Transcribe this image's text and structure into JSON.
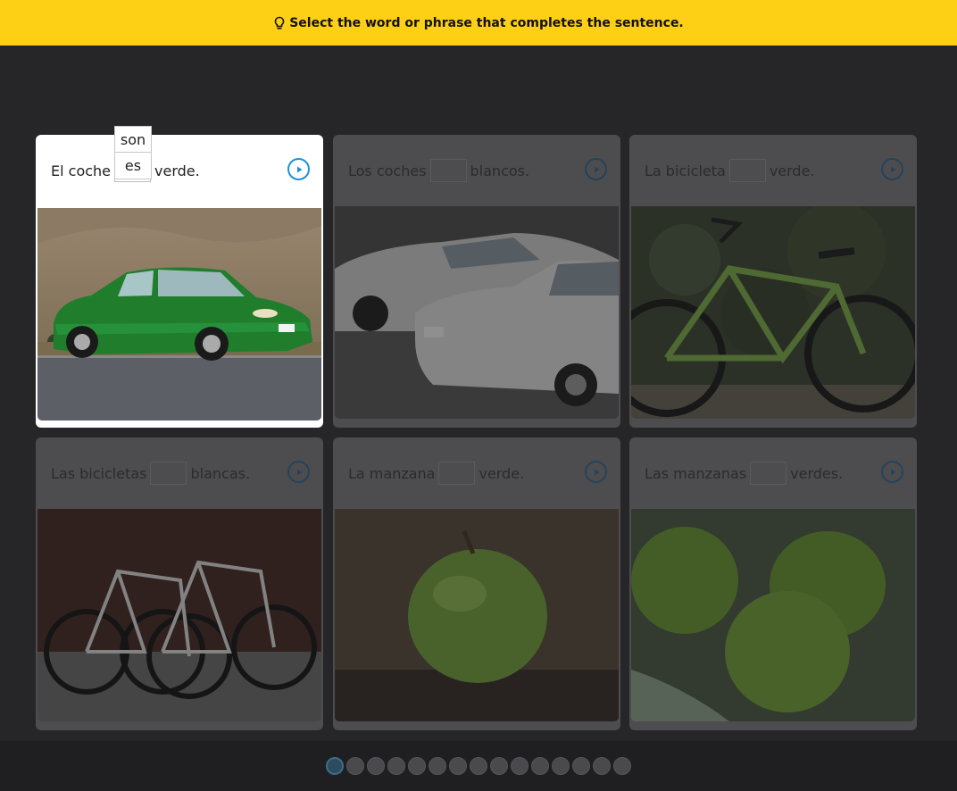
{
  "banner": {
    "instruction": "Select the word or phrase that completes the sentence.",
    "icon": "lightbulb-icon"
  },
  "cards": [
    {
      "before": "El coche",
      "after": "verde.",
      "photo": "green-car"
    },
    {
      "before": "Los coches",
      "after": "blancos.",
      "photo": "white-cars"
    },
    {
      "before": "La bicicleta",
      "after": "verde.",
      "photo": "green-bicycle"
    },
    {
      "before": "Las bicicletas",
      "after": "blancas.",
      "photo": "white-bicycles"
    },
    {
      "before": "La manzana",
      "after": "verde.",
      "photo": "green-apple"
    },
    {
      "before": "Las manzanas",
      "after": "verdes.",
      "photo": "green-apples"
    }
  ],
  "choices": [
    "son",
    "es"
  ],
  "progress": {
    "total": 15,
    "current": 1
  },
  "colors": {
    "banner": "#fdd016",
    "accent": "#1e90d8",
    "background": "#262629"
  }
}
